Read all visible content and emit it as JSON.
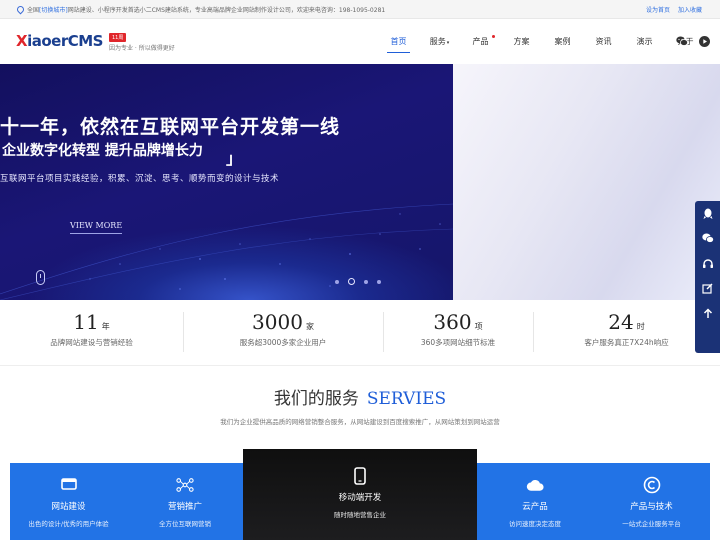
{
  "topbar": {
    "location_prefix": "全国",
    "location_city": "[切换城市]",
    "intro": "网站建设、小程序开发首选小二CMS建站系统，专业高端品牌企业网站制作设计公司，欢迎来电咨询：198-1095-0281",
    "set_home": "设为首页",
    "add_fav": "加入收藏"
  },
  "header": {
    "logo_first": "X",
    "logo_mid": "iaoer",
    "logo_last": "CMS",
    "badge": "11周",
    "slogan": "因为专业 · 所以做得更好"
  },
  "nav": {
    "home": "首页",
    "service": "服务",
    "product": "产品",
    "solution": "方案",
    "cases": "案例",
    "news": "资讯",
    "demo": "演示",
    "about": "关于",
    "caret": "▾"
  },
  "banner": {
    "title": "十一年，依然在互联网平台开发第一线",
    "subtitle": "企业数字化转型 提升品牌增长力",
    "bracket": "」",
    "desc": "互联网平台项目实践经验，积累、沉淀、思考、顺势而变的设计与技术",
    "more": "VIEW MORE",
    "slide_count": 4,
    "active_slide": 2
  },
  "stats": [
    {
      "num": "11",
      "unit": "年",
      "label": "品牌网站建设与营销经验"
    },
    {
      "num": "3000",
      "unit": "家",
      "label": "服务超3000多家企业用户"
    },
    {
      "num": "360",
      "unit": "项",
      "label": "360多项网站细节标准"
    },
    {
      "num": "24",
      "unit": "时",
      "label": "客户服务真正7X24h响应"
    }
  ],
  "services": {
    "title_cn": "我们的服务",
    "title_en": "SERVIES",
    "desc": "我们为企业提供高品质的网络营销整合服务，从网站建设到百度搜索推广，从网站策划到网站运营",
    "cards": [
      {
        "title": "网站建设",
        "sub": "出色的设计/优秀的用户体验",
        "icon": "monitor-icon"
      },
      {
        "title": "营销推广",
        "sub": "全方位互联网营销",
        "icon": "network-icon"
      },
      {
        "title": "移动端开发",
        "sub": "随时随地营售企业",
        "icon": "phone-icon"
      },
      {
        "title": "云产品",
        "sub": "访问速度决定态度",
        "icon": "cloud-icon"
      },
      {
        "title": "产品与技术",
        "sub": "一站式企业服务平台",
        "icon": "copyright-icon"
      }
    ]
  },
  "colors": {
    "accent": "#1f5ed8",
    "brand_red": "#e0262b",
    "card_blue": "#2273e6",
    "side_bar": "#1b3276",
    "banner_dark": "#15166a"
  },
  "side_icons": [
    "qq-icon",
    "wechat-icon",
    "headset-icon",
    "edit-icon",
    "arrow-up-icon"
  ]
}
